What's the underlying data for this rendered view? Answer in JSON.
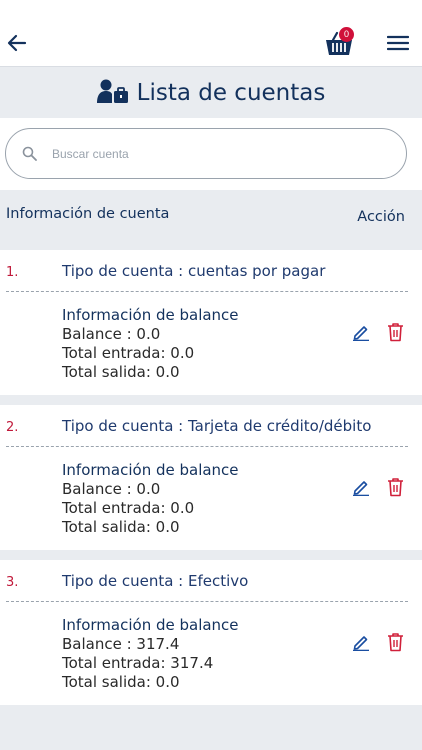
{
  "header": {
    "cart_count": "0"
  },
  "page": {
    "title": "Lista de cuentas"
  },
  "search": {
    "placeholder": "Buscar cuenta"
  },
  "table": {
    "col_info": "Información de cuenta",
    "col_action": "Acción"
  },
  "accounts": [
    {
      "index": "1.",
      "type": "Tipo de cuenta : cuentas por pagar",
      "balance_title": "Información de balance",
      "balance": "Balance : 0.0",
      "total_in": "Total entrada: 0.0",
      "total_out": "Total salida: 0.0"
    },
    {
      "index": "2.",
      "type": "Tipo de cuenta : Tarjeta de crédito/débito",
      "balance_title": "Información de balance",
      "balance": "Balance : 0.0",
      "total_in": "Total entrada: 0.0",
      "total_out": "Total salida: 0.0"
    },
    {
      "index": "3.",
      "type": "Tipo de cuenta : Efectivo",
      "balance_title": "Información de balance",
      "balance": "Balance : 317.4",
      "total_in": "Total entrada: 317.4",
      "total_out": "Total salida: 0.0"
    }
  ],
  "colors": {
    "brand": "#13315c",
    "badge": "#d0103a",
    "edit": "#1a4ea1",
    "delete": "#d0203a",
    "index": "#c0193a"
  },
  "icons": {
    "back": "arrow-left-icon",
    "cart": "basket-icon",
    "menu": "hamburger-menu-icon",
    "title": "user-briefcase-icon",
    "search": "search-icon",
    "edit": "pencil-icon",
    "delete": "trash-icon"
  }
}
